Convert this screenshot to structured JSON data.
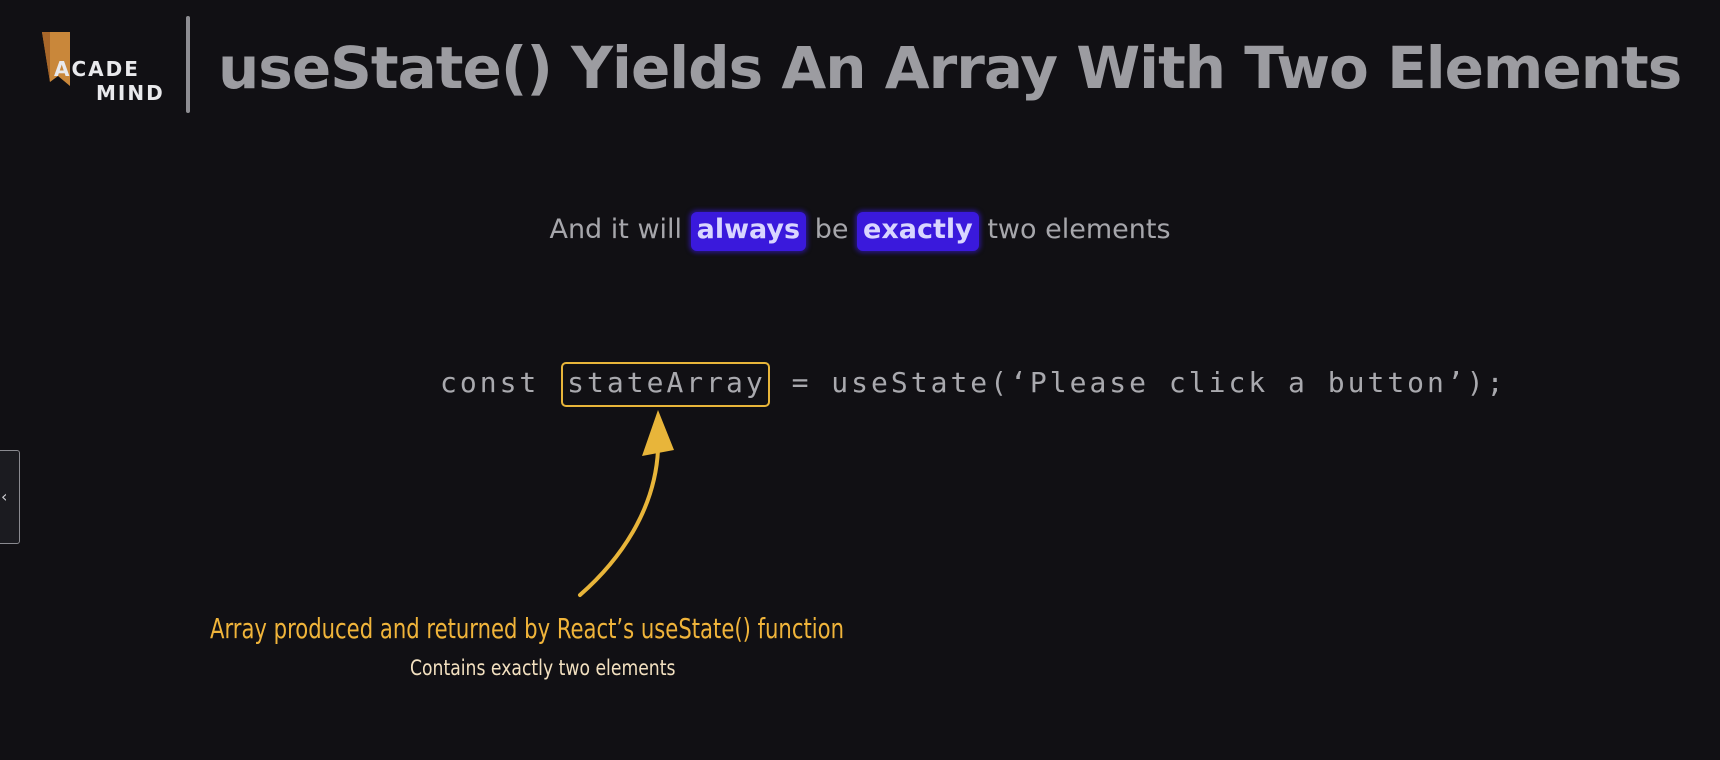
{
  "logo": {
    "line1": "ACADE",
    "line2": "MIND",
    "mark_icon": "bookmark-icon",
    "mark_color": "#c9873a"
  },
  "header": {
    "title": "useState() Yields An Array With Two Elements"
  },
  "subtitle": {
    "before": "And it will ",
    "highlight1": "always",
    "middle": " be ",
    "highlight2": "exactly",
    "after": " two elements",
    "highlight_color": "#3a19dc"
  },
  "code": {
    "prefix": "const ",
    "boxed": "stateArray",
    "suffix": " = useState(‘Please click a button’);",
    "box_color": "#e8b53a"
  },
  "annotation": {
    "main": "Array produced and returned by React’s useState() function",
    "sub": "Contains exactly two elements",
    "color": "#f0b43a"
  },
  "side_tab": {
    "icon": "chevron-left-icon",
    "glyph": "‹"
  }
}
